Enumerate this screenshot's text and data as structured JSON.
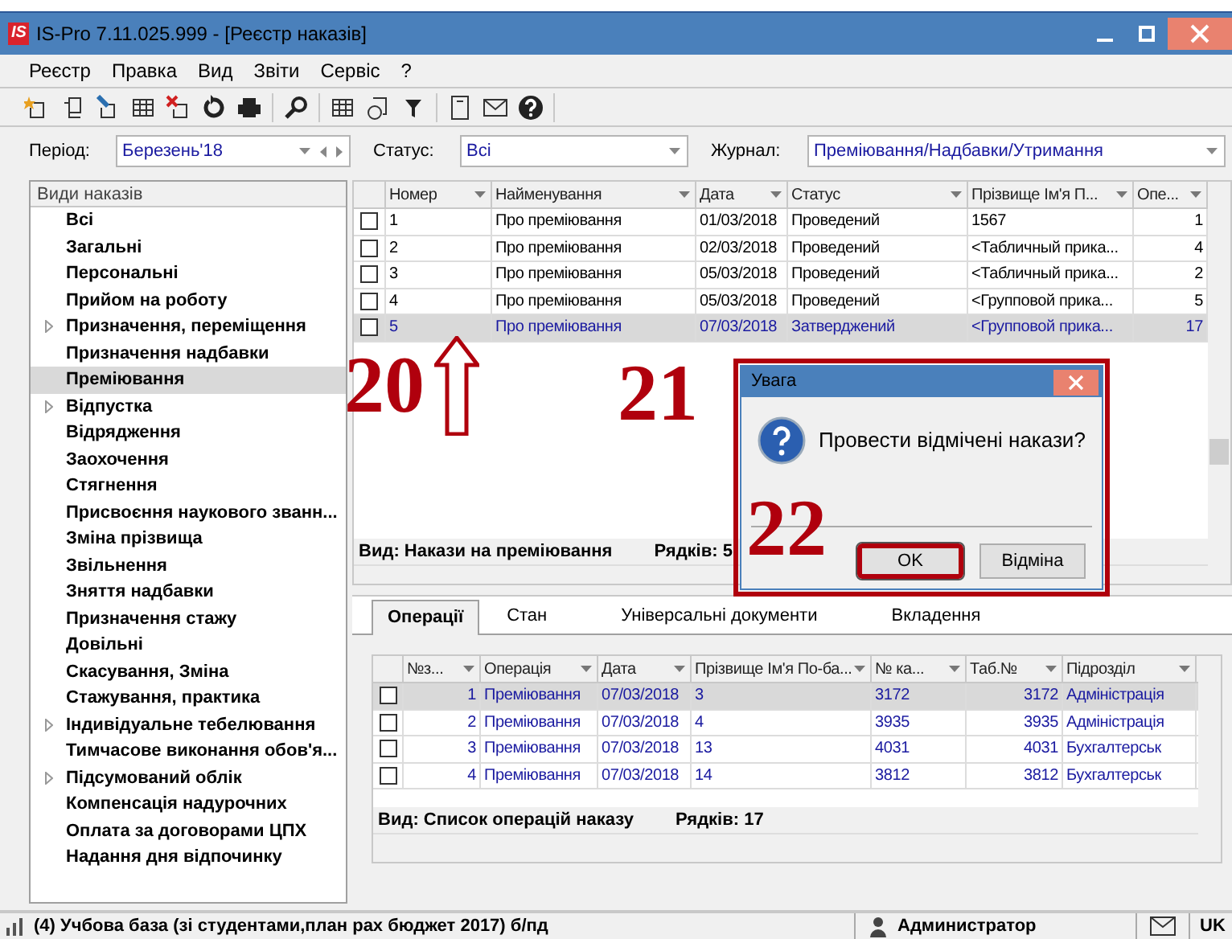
{
  "window": {
    "title": "IS-Pro 7.11.025.999 - [Реєстр наказів]",
    "logo": "IS"
  },
  "menu": [
    "Реєстр",
    "Правка",
    "Вид",
    "Звіти",
    "Сервіс",
    "?"
  ],
  "filters": [
    {
      "label": "Період:",
      "value": "Березень'18",
      "kind": "period"
    },
    {
      "label": "Статус:",
      "value": "Всі",
      "kind": "combo"
    },
    {
      "label": "Журнал:",
      "value": "Премiювання/Надбавки/Утримання",
      "kind": "combo"
    }
  ],
  "sidebar": {
    "title": "Види наказів",
    "items": [
      {
        "label": "Всі",
        "kind": "leaf",
        "selected": false
      },
      {
        "label": "Загальні",
        "kind": "leaf",
        "selected": false
      },
      {
        "label": "Персональні",
        "kind": "leaf",
        "selected": false
      },
      {
        "label": "Прийом на роботу",
        "kind": "leaf",
        "selected": false
      },
      {
        "label": "Призначення, переміщення",
        "kind": "group",
        "selected": false
      },
      {
        "label": "Призначення надбавки",
        "kind": "leaf",
        "selected": false
      },
      {
        "label": "Преміювання",
        "kind": "leaf",
        "selected": true
      },
      {
        "label": "Відпустка",
        "kind": "group",
        "selected": false
      },
      {
        "label": "Відрядження",
        "kind": "leaf",
        "selected": false
      },
      {
        "label": "Заохочення",
        "kind": "leaf",
        "selected": false
      },
      {
        "label": "Стягнення",
        "kind": "leaf",
        "selected": false
      },
      {
        "label": "Присвоєння наукового званн...",
        "kind": "leaf",
        "selected": false
      },
      {
        "label": "Зміна прізвища",
        "kind": "leaf",
        "selected": false
      },
      {
        "label": "Звільнення",
        "kind": "leaf",
        "selected": false
      },
      {
        "label": "Зняття надбавки",
        "kind": "leaf",
        "selected": false
      },
      {
        "label": "Призначення стажу",
        "kind": "leaf",
        "selected": false
      },
      {
        "label": "Довільні",
        "kind": "leaf",
        "selected": false
      },
      {
        "label": "Скасування, Зміна",
        "kind": "leaf",
        "selected": false
      },
      {
        "label": "Стажування, практика",
        "kind": "leaf",
        "selected": false
      },
      {
        "label": "Індивідуальне тебелювання",
        "kind": "group",
        "selected": false
      },
      {
        "label": "Тимчасове виконання обов'я...",
        "kind": "leaf",
        "selected": false
      },
      {
        "label": "Підсумований облік",
        "kind": "group",
        "selected": false
      },
      {
        "label": "Компенсація надурочних",
        "kind": "leaf",
        "selected": false
      },
      {
        "label": "Оплата за договорами ЦПХ",
        "kind": "leaf",
        "selected": false
      },
      {
        "label": "Надання дня відпочинку",
        "kind": "leaf",
        "selected": false
      }
    ]
  },
  "orders_table": {
    "columns": [
      "Номер",
      "Найменування",
      "Дата",
      "Статус",
      "Прізвище Ім'я П...",
      "Опе..."
    ],
    "rows": [
      {
        "checked": false,
        "selected": false,
        "cells": [
          "1",
          "Про премiювання",
          "01/03/2018",
          "Проведений",
          "1567",
          "1"
        ]
      },
      {
        "checked": false,
        "selected": false,
        "cells": [
          "2",
          "Про премiювання",
          "02/03/2018",
          "Проведений",
          "<Табличный прика...",
          "4"
        ]
      },
      {
        "checked": false,
        "selected": false,
        "cells": [
          "3",
          "Про премiювання",
          "05/03/2018",
          "Проведений",
          "<Табличный прика...",
          "2"
        ]
      },
      {
        "checked": false,
        "selected": false,
        "cells": [
          "4",
          "Про премiювання",
          "05/03/2018",
          "Проведений",
          "<Групповой прика...",
          "5"
        ]
      },
      {
        "checked": false,
        "selected": true,
        "cells": [
          "5",
          "Про премiювання",
          "07/03/2018",
          "Затверджений",
          "<Групповой прика...",
          "17"
        ]
      }
    ],
    "footer": {
      "view": "Вид: Накази на премiювання",
      "rows": "Рядків: 5"
    }
  },
  "tabs": [
    {
      "label": "Операції",
      "selected": true
    },
    {
      "label": "Стан",
      "selected": false
    },
    {
      "label": "Універсальні документи",
      "selected": false
    },
    {
      "label": "Вкладення",
      "selected": false
    }
  ],
  "operations_table": {
    "columns": [
      "№з...",
      "Операція",
      "Дата",
      "Прізвище Ім'я По-ба...",
      "№ ка...",
      "Таб.№",
      "Підрозділ"
    ],
    "rows": [
      {
        "checked": false,
        "selected": true,
        "cells": [
          "1",
          "Премiювання",
          "07/03/2018",
          "3",
          "3172",
          "3172",
          "Адміністрація"
        ]
      },
      {
        "checked": false,
        "selected": false,
        "cells": [
          "2",
          "Премiювання",
          "07/03/2018",
          "4",
          "3935",
          "3935",
          "Адміністрація"
        ]
      },
      {
        "checked": false,
        "selected": false,
        "cells": [
          "3",
          "Премiювання",
          "07/03/2018",
          "13",
          "4031",
          "4031",
          "Бухгалтерськ"
        ]
      },
      {
        "checked": false,
        "selected": false,
        "cells": [
          "4",
          "Премiювання",
          "07/03/2018",
          "14",
          "3812",
          "3812",
          "Бухгалтерськ"
        ]
      }
    ],
    "footer": {
      "view": "Вид: Список операцій наказу",
      "rows": "Рядків: 17"
    }
  },
  "dialog": {
    "title": "Увага",
    "message": "Провести відмічені накази?",
    "buttons": [
      {
        "label": "OK",
        "highlighted": true
      },
      {
        "label": "Відміна",
        "highlighted": false
      }
    ]
  },
  "annotations": [
    "20",
    "21",
    "22"
  ],
  "status_bar": {
    "database": "(4) Учбова база (зі студентами,план рах бюджет 2017) б/пд",
    "user": "Администратор",
    "language": "UK"
  }
}
